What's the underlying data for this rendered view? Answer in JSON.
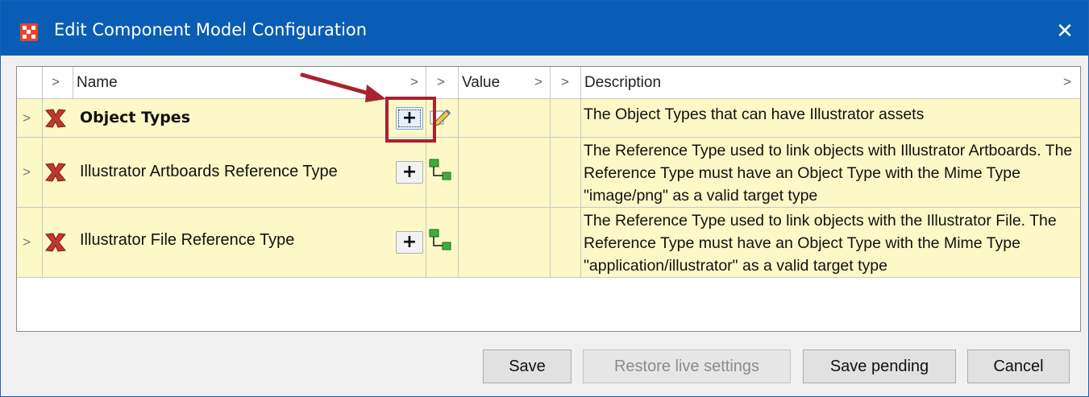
{
  "window": {
    "title": "Edit Component Model Configuration",
    "close_glyph": "✕",
    "app_icon": "app-logo-icon"
  },
  "grid": {
    "columns": [
      {
        "label": ""
      },
      {
        "label": "Name"
      },
      {
        "label": "Value"
      },
      {
        "label": "Description"
      }
    ],
    "chevron": ">",
    "rows": [
      {
        "name": "Object Types",
        "bold": true,
        "add_label": "+",
        "focused": true,
        "edit_icon": "edit-pencil-icon",
        "description": "The Object Types that can have Illustrator assets"
      },
      {
        "name": "Illustrator Artboards Reference Type",
        "bold": false,
        "add_label": "+",
        "edit_icon": "reference-link-icon",
        "description": "The Reference Type used to link objects with Illustrator Artboards. The Reference Type must have an Object Type with the Mime Type \"image/png\" as a valid target type"
      },
      {
        "name": "Illustrator File Reference Type",
        "bold": false,
        "add_label": "+",
        "edit_icon": "reference-link-icon",
        "description": "The Reference Type used to link objects with the Illustrator File. The Reference Type must have an Object Type with the Mime Type \"application/illustrator\" as a valid target type"
      }
    ]
  },
  "buttons": {
    "save": "Save",
    "restore": "Restore live settings",
    "save_pending": "Save pending",
    "cancel": "Cancel"
  },
  "colors": {
    "titlebar": "#0a5db4",
    "row_bg": "#fdf8c7",
    "annotation": "#a82230",
    "delete_icon": "#c0392b"
  }
}
